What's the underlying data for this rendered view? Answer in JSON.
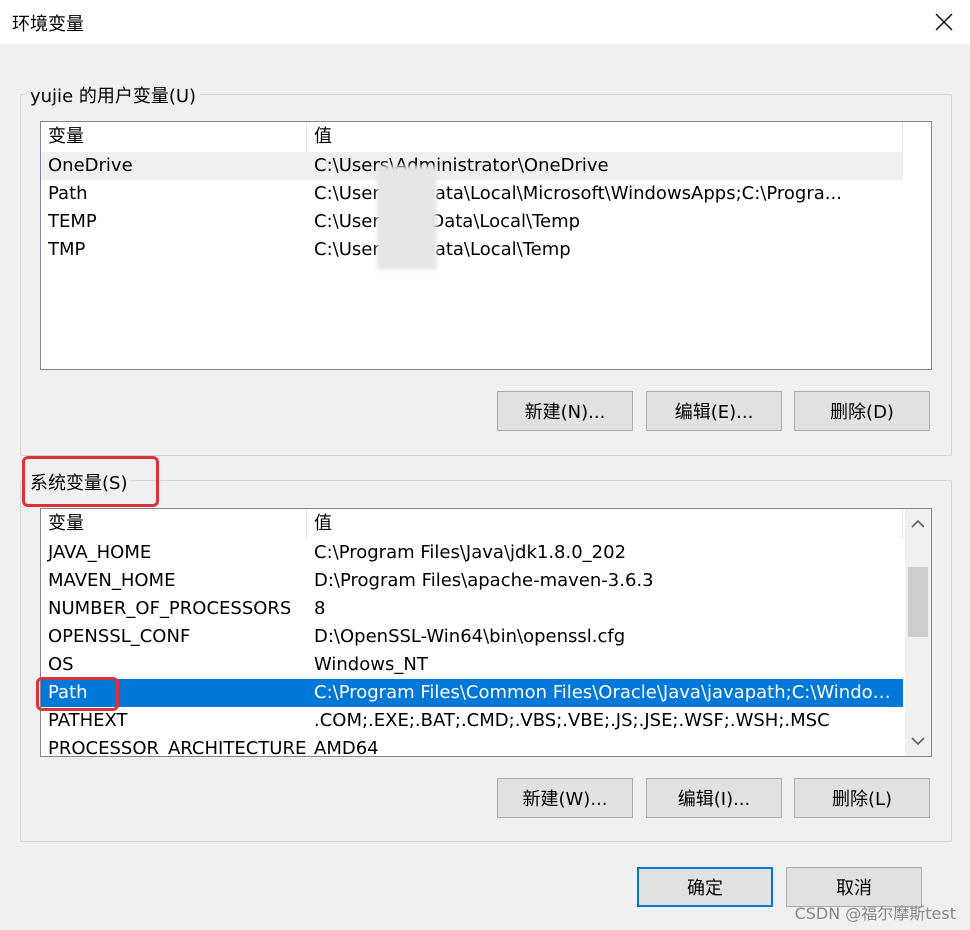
{
  "window": {
    "title": "环境变量",
    "close_icon": "close-icon"
  },
  "user_vars": {
    "group_label": "yujie 的用户变量(U)",
    "columns": [
      "变量",
      "值"
    ],
    "rows": [
      {
        "name": "OneDrive",
        "value": "C:\\Users\\Administrator\\OneDrive"
      },
      {
        "name": "Path",
        "value": "C:\\User\\AppData\\Local\\Microsoft\\WindowsApps;C:\\Progra..."
      },
      {
        "name": "TEMP",
        "value": "C:\\Users\\AppData\\Local\\Temp"
      },
      {
        "name": "TMP",
        "value": "C:\\User\\AppData\\Local\\Temp"
      }
    ],
    "buttons": {
      "new": "新建(N)...",
      "edit": "编辑(E)...",
      "delete": "删除(D)"
    }
  },
  "system_vars": {
    "group_label": "系统变量(S)",
    "columns": [
      "变量",
      "值"
    ],
    "rows": [
      {
        "name": "JAVA_HOME",
        "value": "C:\\Program Files\\Java\\jdk1.8.0_202"
      },
      {
        "name": "MAVEN_HOME",
        "value": "D:\\Program Files\\apache-maven-3.6.3"
      },
      {
        "name": "NUMBER_OF_PROCESSORS",
        "value": "8"
      },
      {
        "name": "OPENSSL_CONF",
        "value": "D:\\OpenSSL-Win64\\bin\\openssl.cfg"
      },
      {
        "name": "OS",
        "value": "Windows_NT"
      },
      {
        "name": "Path",
        "value": "C:\\Program Files\\Common Files\\Oracle\\Java\\javapath;C:\\Windows\\..."
      },
      {
        "name": "PATHEXT",
        "value": ".COM;.EXE;.BAT;.CMD;.VBS;.VBE;.JS;.JSE;.WSF;.WSH;.MSC"
      },
      {
        "name": "PROCESSOR_ARCHITECTURE",
        "value": "AMD64"
      }
    ],
    "selected_index": 5,
    "buttons": {
      "new": "新建(W)...",
      "edit": "编辑(I)...",
      "delete": "删除(L)"
    }
  },
  "footer": {
    "ok": "确定",
    "cancel": "取消"
  },
  "watermark": "CSDN @福尔摩斯test",
  "colors": {
    "selection": "#0078d7",
    "highlight": "#e0303a"
  }
}
